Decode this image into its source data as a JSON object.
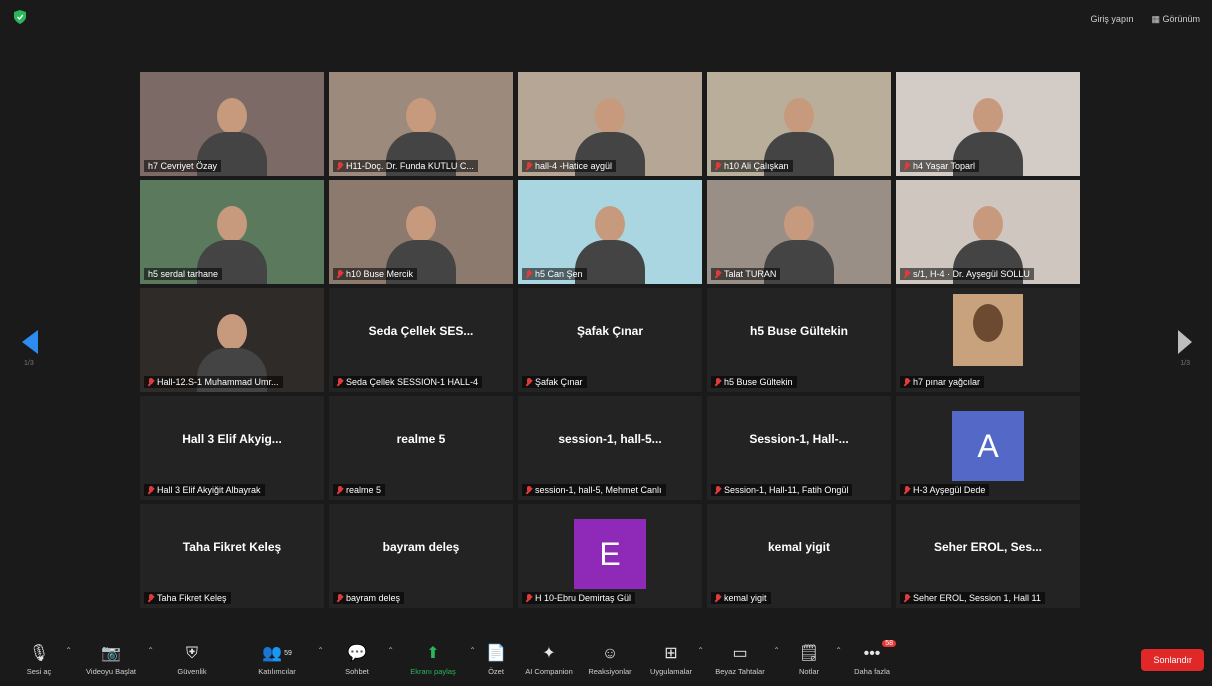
{
  "colors": {
    "end": "#e02828",
    "share": "#2bb55d",
    "arrow": "#2e8cf0"
  },
  "topbar": {
    "fullscreen": "Giriş yapın",
    "view": "Görünüm"
  },
  "pager": {
    "left": "1/3",
    "right": "1/3"
  },
  "tiles": [
    {
      "label": "h7 Cevriyet Özay",
      "video": true,
      "color": "#7b6a66"
    },
    {
      "label": "H11-Doç. Dr. Funda KUTLU C...",
      "video": true,
      "color": "#9c8a7c"
    },
    {
      "label": "hall-4 -Hatice aygül",
      "video": true,
      "color": "#b5a695"
    },
    {
      "label": "h10 Ali Çalışkan",
      "video": true,
      "color": "#b8ae99"
    },
    {
      "label": "h4 Yaşar Toparl",
      "video": true,
      "color": "#d3ccc6"
    },
    {
      "label": "h5 serdal tarhane",
      "video": true,
      "color": "#5b7a5d"
    },
    {
      "label": "h10 Buse Mercik",
      "video": true,
      "color": "#8c7a6e"
    },
    {
      "label": "h5 Can Şen",
      "video": true,
      "color": "#a9d6e0"
    },
    {
      "label": "Talat TURAN",
      "video": true,
      "color": "#9a8f86"
    },
    {
      "label": "s/1, H-4 · Dr. Ayşegül SOLLU",
      "video": true,
      "color": "#cfc7bf"
    },
    {
      "label": "Hall-12.S-1 Muhammad Umr...",
      "video": true,
      "color": "#2f2b28"
    },
    {
      "name": "Seda Çellek SES...",
      "label": "Seda Çellek SESSION-1 HALL-4"
    },
    {
      "name": "Şafak Çınar",
      "label": "Şafak Çınar"
    },
    {
      "name": "h5 Buse Gültekin",
      "label": "h5 Buse Gültekin"
    },
    {
      "label": "h7 pınar yağcılar",
      "photo": true
    },
    {
      "name": "Hall 3 Elif Akyig...",
      "label": "Hall 3 Elif Akyiğit Albayrak"
    },
    {
      "name": "realme 5",
      "label": "realme 5"
    },
    {
      "name": "session-1, hall-5...",
      "label": "session-1, hall-5, Mehmet Canlı"
    },
    {
      "name": "Session-1, Hall-...",
      "label": "Session-1, Hall-11, Fatih Ongül"
    },
    {
      "avatar": "A",
      "avatarColor": "#5468c7",
      "label": "H-3 Ayşegül Dede"
    },
    {
      "name": "Taha Fikret Keleş",
      "label": "Taha Fikret Keleş"
    },
    {
      "name": "bayram deleş",
      "label": "bayram deleş"
    },
    {
      "avatar": "E",
      "avatarColor": "#8e2ab7",
      "label": "H 10-Ebru Demirtaş Gül"
    },
    {
      "name": "kemal yigit",
      "label": "kemal yigit"
    },
    {
      "name": "Seher EROL, Ses...",
      "label": "Seher EROL, Session 1, Hall 11"
    }
  ],
  "toolbar": {
    "audio": "Sesi aç",
    "video": "Videoyu Başlat",
    "security": "Güvenlik",
    "participants": "Katılımcılar",
    "participants_count": "59",
    "chat": "Sohbet",
    "share": "Ekranı paylaş",
    "summary": "Özet",
    "companion": "AI Companion",
    "reactions": "Reaksiyonlar",
    "apps": "Uygulamalar",
    "whiteboard": "Beyaz Tahtalar",
    "notes": "Notlar",
    "more": "Daha fazla",
    "more_badge": "58",
    "end": "Sonlandır"
  }
}
